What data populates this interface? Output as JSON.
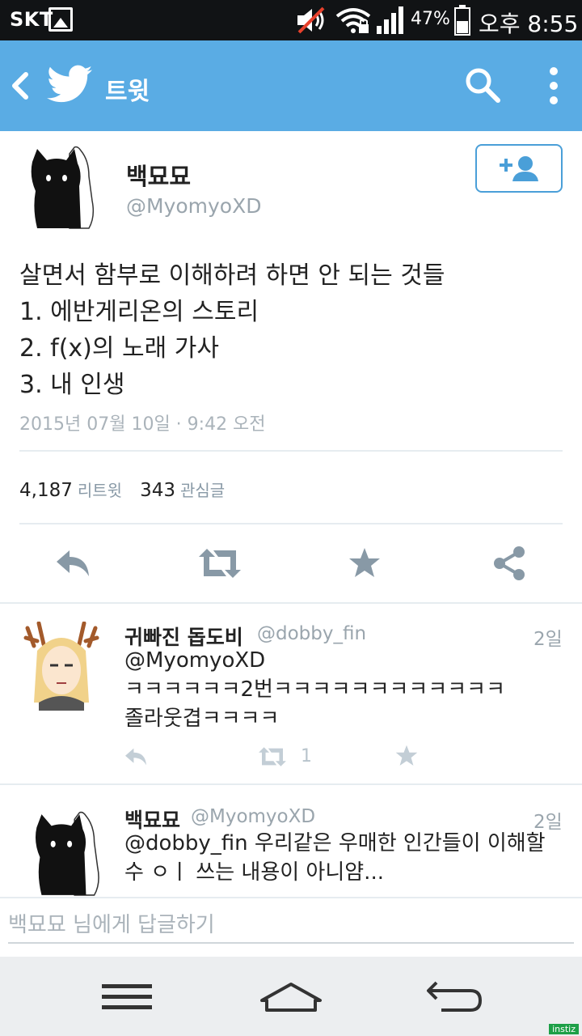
{
  "status_bar": {
    "carrier": "SKT",
    "battery_percent": "47%",
    "time": "오후 8:55"
  },
  "app_bar": {
    "title": "트윗"
  },
  "tweet": {
    "author_name": "백묘묘",
    "author_handle": "@MyomyoXD",
    "lines": [
      "살면서 함부로 이해하려 하면 안 되는 것들",
      "1. 에반게리온의 스토리",
      "2. f(x)의 노래 가사",
      "3. 내 인생"
    ],
    "timestamp": "2015년 07월 10일 · 9:42 오전",
    "retweet_count": "4,187",
    "retweet_label": "리트윗",
    "favorite_count": "343",
    "favorite_label": "관심글"
  },
  "replies": [
    {
      "name": "귀빠진 돕도비",
      "handle": "@dobby_fin",
      "date": "2일",
      "lines": [
        "@MyomyoXD",
        "ㅋㅋㅋㅋㅋㅋ2번ㅋㅋㅋㅋㅋㅋㅋㅋㅋㅋㅋㅋ",
        "졸라웃겹ㅋㅋㅋㅋ"
      ],
      "retweet_count": "1"
    },
    {
      "name": "백묘묘",
      "handle": "@MyomyoXD",
      "date": "2일",
      "lines": [
        "@dobby_fin 우리같은 우매한 인간들이 이해할",
        "수 ㅇㅣ 쓰는 내용이 아니얌..."
      ]
    }
  ],
  "reply_box": {
    "placeholder": "백묘묘 님에게 답글하기"
  },
  "watermark": "instiz",
  "colors": {
    "brand_blue": "#5aace4",
    "icon_gray": "#8899a6",
    "muted_text": "#9aa5ad"
  },
  "icons": [
    "back-icon",
    "twitter-bird-icon",
    "search-icon",
    "more-icon",
    "add-user-icon",
    "reply-icon",
    "retweet-icon",
    "favorite-icon",
    "share-icon",
    "menu-icon",
    "home-icon",
    "back-nav-icon"
  ]
}
